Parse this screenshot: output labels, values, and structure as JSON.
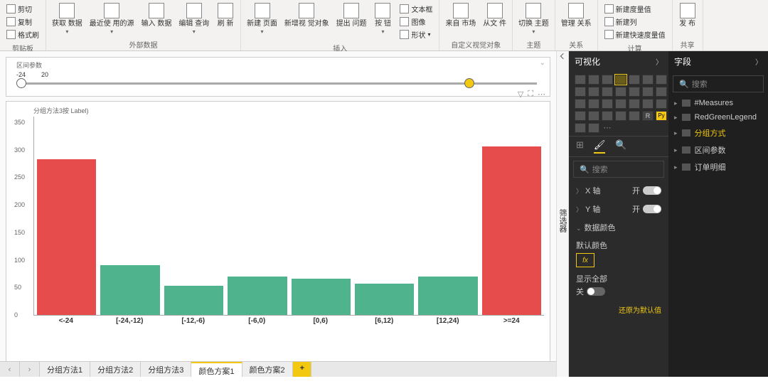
{
  "ribbon": {
    "clipboard": {
      "label": "剪贴板",
      "cut": "剪切",
      "copy": "复制",
      "format": "格式刷"
    },
    "data": {
      "label": "外部数据",
      "get": "获取\n数据",
      "recent": "最近使\n用的源",
      "input": "输入\n数据",
      "edit": "编辑\n查询",
      "refresh": "刷\n新"
    },
    "insert": {
      "label": "插入",
      "newpage": "新建\n页面",
      "visual": "新增视\n觉对象",
      "ask": "提出\n问题",
      "buttons": "按\n钮",
      "textbox": "文本框",
      "image": "图像",
      "shapes": "形状"
    },
    "custom": {
      "label": "自定义视觉对象",
      "market": "来自\n市场",
      "file": "从文\n件"
    },
    "theme": {
      "label": "主题",
      "switch": "切换\n主题"
    },
    "rel": {
      "label": "关系",
      "manage": "管理\n关系"
    },
    "calc": {
      "label": "计算",
      "measure": "新建度量值",
      "column": "新建列",
      "quick": "新建快速度量值"
    },
    "share": {
      "label": "共享",
      "publish": "发\n布"
    }
  },
  "slicer": {
    "title": "区间参数",
    "min": "-24",
    "max": "20"
  },
  "chart_data": {
    "type": "bar",
    "title": "分组方法3按 Label)",
    "categories": [
      "<-24",
      "[-24,-12)",
      "[-12,-6)",
      "[-6,0)",
      "[0,6)",
      "[6,12)",
      "[12,24)",
      ">=24"
    ],
    "values": [
      282,
      90,
      53,
      70,
      65,
      57,
      70,
      305
    ],
    "colors": [
      "#e74c4c",
      "#4fb38d",
      "#4fb38d",
      "#4fb38d",
      "#4fb38d",
      "#4fb38d",
      "#4fb38d",
      "#e74c4c"
    ],
    "ylim": [
      0,
      360
    ],
    "yticks": [
      0,
      50,
      100,
      150,
      200,
      250,
      300,
      350
    ]
  },
  "vizpane": {
    "title": "可视化",
    "search": "搜索",
    "xaxis": "X 轴",
    "yaxis": "Y 轴",
    "on": "开",
    "datacolor": "数据颜色",
    "defaultcolor": "默认颜色",
    "showall": "显示全部",
    "off": "关",
    "reset": "还原为默认值"
  },
  "fieldpane": {
    "title": "字段",
    "search": "搜索",
    "items": [
      "#Measures",
      "RedGreenLegend",
      "分组方式",
      "区间参数",
      "订单明细"
    ]
  },
  "tabs": {
    "items": [
      "分组方法1",
      "分组方法2",
      "分组方法3",
      "颜色方案1",
      "颜色方案2"
    ],
    "active": 3,
    "add": "+"
  }
}
